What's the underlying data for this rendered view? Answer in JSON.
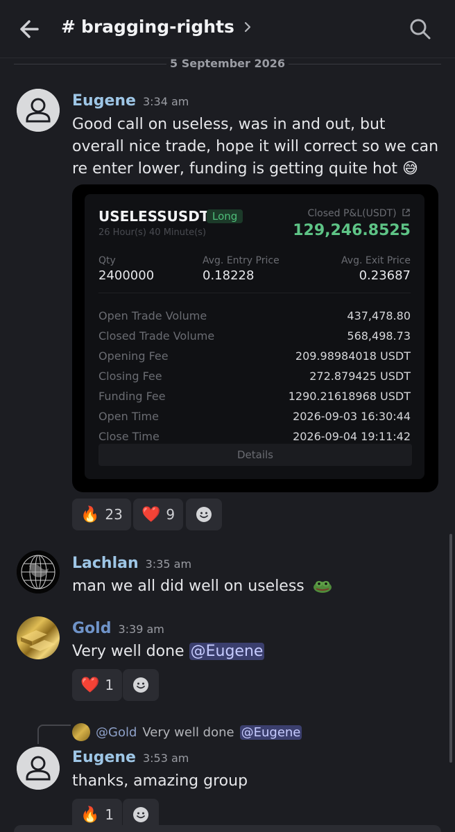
{
  "header": {
    "channel_hash": "#",
    "channel_name": "bragging-rights"
  },
  "divider": {
    "date": "5 September 2026"
  },
  "messages": [
    {
      "username": "Eugene",
      "username_color": "#9ec6e6",
      "time": "3:34 am",
      "text": "Good call on useless, was in and out, but overall nice trade, hope it will correct so we can re enter lower, funding is getting quite hot 😅"
    },
    {
      "username": "Lachlan",
      "username_color": "#9ec6e6",
      "time": "3:35 am",
      "text": "man we all did well on useless"
    },
    {
      "username": "Gold",
      "username_color": "#6f93c8",
      "time": "3:39 am",
      "text": "Very well done",
      "mention": "@Eugene"
    },
    {
      "username": "Eugene",
      "username_color": "#9ec6e6",
      "time": "3:53 am",
      "text": "thanks, amazing group",
      "reply_to": {
        "user": "@Gold",
        "text": "Very well done",
        "mention": "@Eugene"
      }
    }
  ],
  "trade_card": {
    "pair": "USELESSUSDT",
    "side": "Long",
    "duration": "26 Hour(s) 40 Minute(s)",
    "pnl_label": "Closed P&L(USDT)",
    "pnl_value": "129,246.8525",
    "qty_label": "Qty",
    "qty_value": "2400000",
    "entry_label": "Avg. Entry Price",
    "entry_value": "0.18228",
    "exit_label": "Avg. Exit Price",
    "exit_value": "0.23687",
    "rows": [
      {
        "label": "Open Trade Volume",
        "value": "437,478.80"
      },
      {
        "label": "Closed Trade Volume",
        "value": "568,498.73"
      },
      {
        "label": "Opening Fee",
        "value": "209.98984018 USDT"
      },
      {
        "label": "Closing Fee",
        "value": "272.879425 USDT"
      },
      {
        "label": "Funding Fee",
        "value": "1290.21618968 USDT"
      },
      {
        "label": "Open Time",
        "value": "2026-09-03 16:30:44"
      },
      {
        "label": "Close Time",
        "value": "2026-09-04 19:11:42"
      }
    ],
    "details_label": "Details"
  },
  "reactions": {
    "msg1": [
      {
        "emoji": "🔥",
        "count": "23"
      },
      {
        "emoji": "❤️",
        "count": "9"
      }
    ],
    "msg3": [
      {
        "emoji": "❤️",
        "count": "1"
      }
    ],
    "msg4": [
      {
        "emoji": "🔥",
        "count": "1"
      }
    ]
  },
  "icons": {
    "back": "arrow-left-icon",
    "search": "search-icon",
    "add_reaction": "smiley-icon"
  }
}
